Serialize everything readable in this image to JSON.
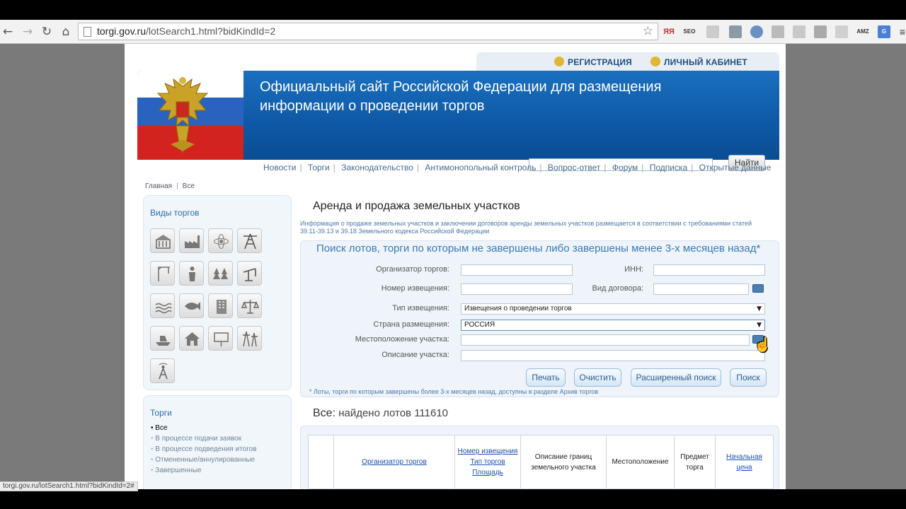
{
  "browser": {
    "url_domain": "torgi.gov.ru",
    "url_path": "/lotSearch1.html?bidKindId=2",
    "extensions": [
      "ЯЯ",
      "SEO",
      "AMZ"
    ],
    "status_url": "torgi.gov.ru/lotSearch1.html?bidKindId=2#"
  },
  "header": {
    "register_label": "РЕГИСТРАЦИЯ",
    "cabinet_label": "ЛИЧНЫЙ КАБИНЕТ",
    "title": "Официальный сайт Российской Федерации для размещения информации о проведении торгов",
    "search_button": "Найти"
  },
  "nav": {
    "items": [
      "Новости",
      "Торги",
      "Законодательство",
      "Антимонопольный контроль",
      "Вопрос-ответ",
      "Форум",
      "Подписка",
      "Открытые данные"
    ]
  },
  "breadcrumb": [
    "Главная",
    "Все"
  ],
  "sidebar": {
    "types_title": "Виды торгов",
    "icons": [
      "building-icon",
      "factory-icon",
      "atom-icon",
      "tower-icon",
      "crane-icon",
      "worker-icon",
      "forest-icon",
      "oil-pump-icon",
      "water-icon",
      "fish-icon",
      "office-building-icon",
      "scales-icon",
      "boat-icon",
      "house-icon",
      "billboard-icon",
      "power-line-icon",
      "antenna-icon"
    ],
    "torgi_title": "Торги",
    "statuses": [
      "Все",
      "В процессе подачи заявок",
      "В процессе подведения итогов",
      "Отмененные/аннулированные",
      "Завершенные"
    ]
  },
  "content": {
    "title": "Аренда и продажа земельных участков",
    "description": "Информация о продаже земельных участков и заключении договоров аренды земельных участков размещается в соответствии с требованиями статей 39.11-39.13 и 39.18 Земельного кодекса Российской Федерации"
  },
  "search_form": {
    "title": "Поиск лотов, торги по которым не завершены либо завершены менее 3-х месяцев назад*",
    "organizer_label": "Организатор торгов:",
    "inn_label": "ИНН:",
    "notice_number_label": "Номер извещения:",
    "contract_type_label": "Вид договора:",
    "notice_type_label": "Тип извещения:",
    "notice_type_value": "Извещения о проведении торгов",
    "country_label": "Страна размещения:",
    "country_value": "РОССИЯ",
    "location_label": "Местоположение участка:",
    "description_label": "Описание участка:",
    "print_button": "Печать",
    "clear_button": "Очистить",
    "advanced_button": "Расширенный поиск",
    "search_button": "Поиск",
    "note": "* Лоты, торги по которым завершены более 3-х месяцев назад, доступны в разделе Архив торгов"
  },
  "results": {
    "label": "Все:",
    "count_text": "найдено лотов 111610",
    "columns": [
      "Организатор торгов",
      "Номер извещения",
      "Тип торгов",
      "Площадь",
      "Описание границ земельного участка",
      "Местоположение",
      "Предмет торга",
      "Начальная цена"
    ]
  }
}
